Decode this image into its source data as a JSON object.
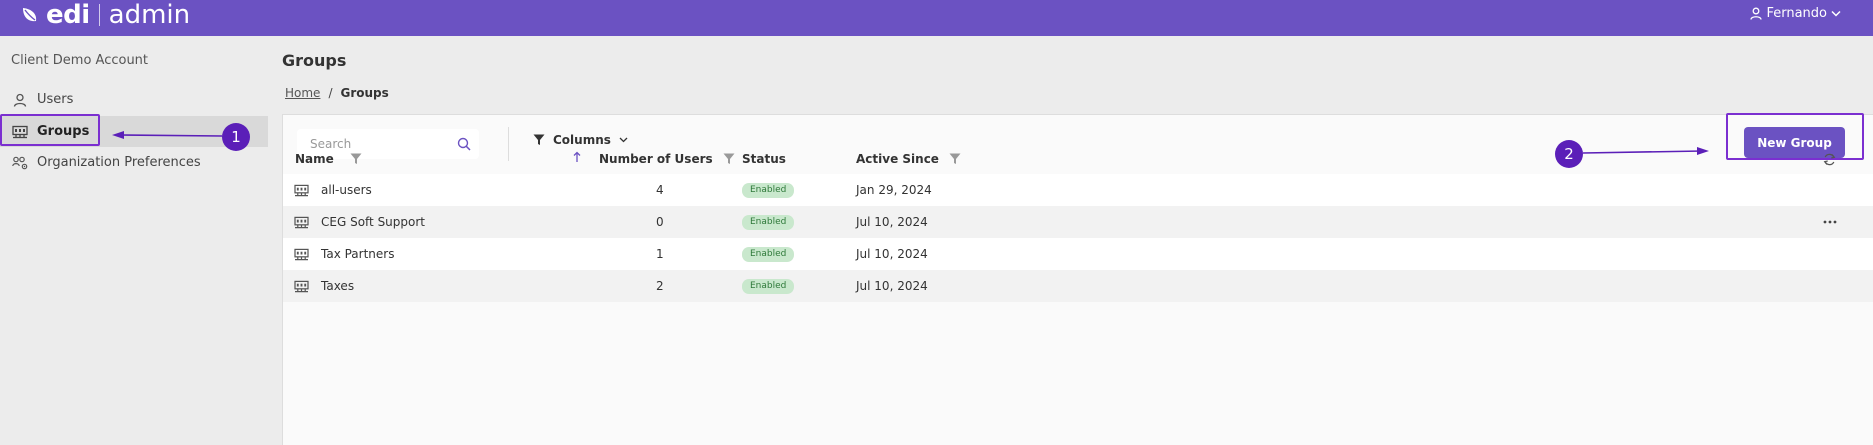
{
  "topbar": {
    "brand_name": "edi",
    "brand_suffix": "admin",
    "user_name": "Fernando",
    "bg_color": "#6b52c2"
  },
  "sidebar": {
    "account_name": "Client Demo Account",
    "items": [
      {
        "label": "Users",
        "icon": "user-icon",
        "active": false
      },
      {
        "label": "Groups",
        "icon": "groups-icon",
        "active": true
      },
      {
        "label": "Organization Preferences",
        "icon": "people-gear-icon",
        "active": false
      }
    ]
  },
  "main": {
    "title": "Groups",
    "breadcrumb": {
      "home": "Home",
      "separator": "/",
      "current": "Groups"
    }
  },
  "toolbar": {
    "search_placeholder": "Search",
    "search_value": "",
    "columns_label": "Columns",
    "new_group_label": "New Group"
  },
  "table": {
    "columns": [
      "Name",
      "Number of Users",
      "Status",
      "Active Since"
    ],
    "sort": {
      "column": "Name",
      "direction": "ascending"
    },
    "rows": [
      {
        "name": "all-users",
        "users": "4",
        "status": "Enabled",
        "active_since": "Jan 29, 2024"
      },
      {
        "name": "CEG Soft Support",
        "users": "0",
        "status": "Enabled",
        "active_since": "Jul 10, 2024"
      },
      {
        "name": "Tax Partners",
        "users": "1",
        "status": "Enabled",
        "active_since": "Jul 10, 2024"
      },
      {
        "name": "Taxes",
        "users": "2",
        "status": "Enabled",
        "active_since": "Jul 10, 2024"
      }
    ]
  },
  "annotations": {
    "callout_1": "1",
    "callout_2": "2",
    "color": "#5b1fb8"
  }
}
